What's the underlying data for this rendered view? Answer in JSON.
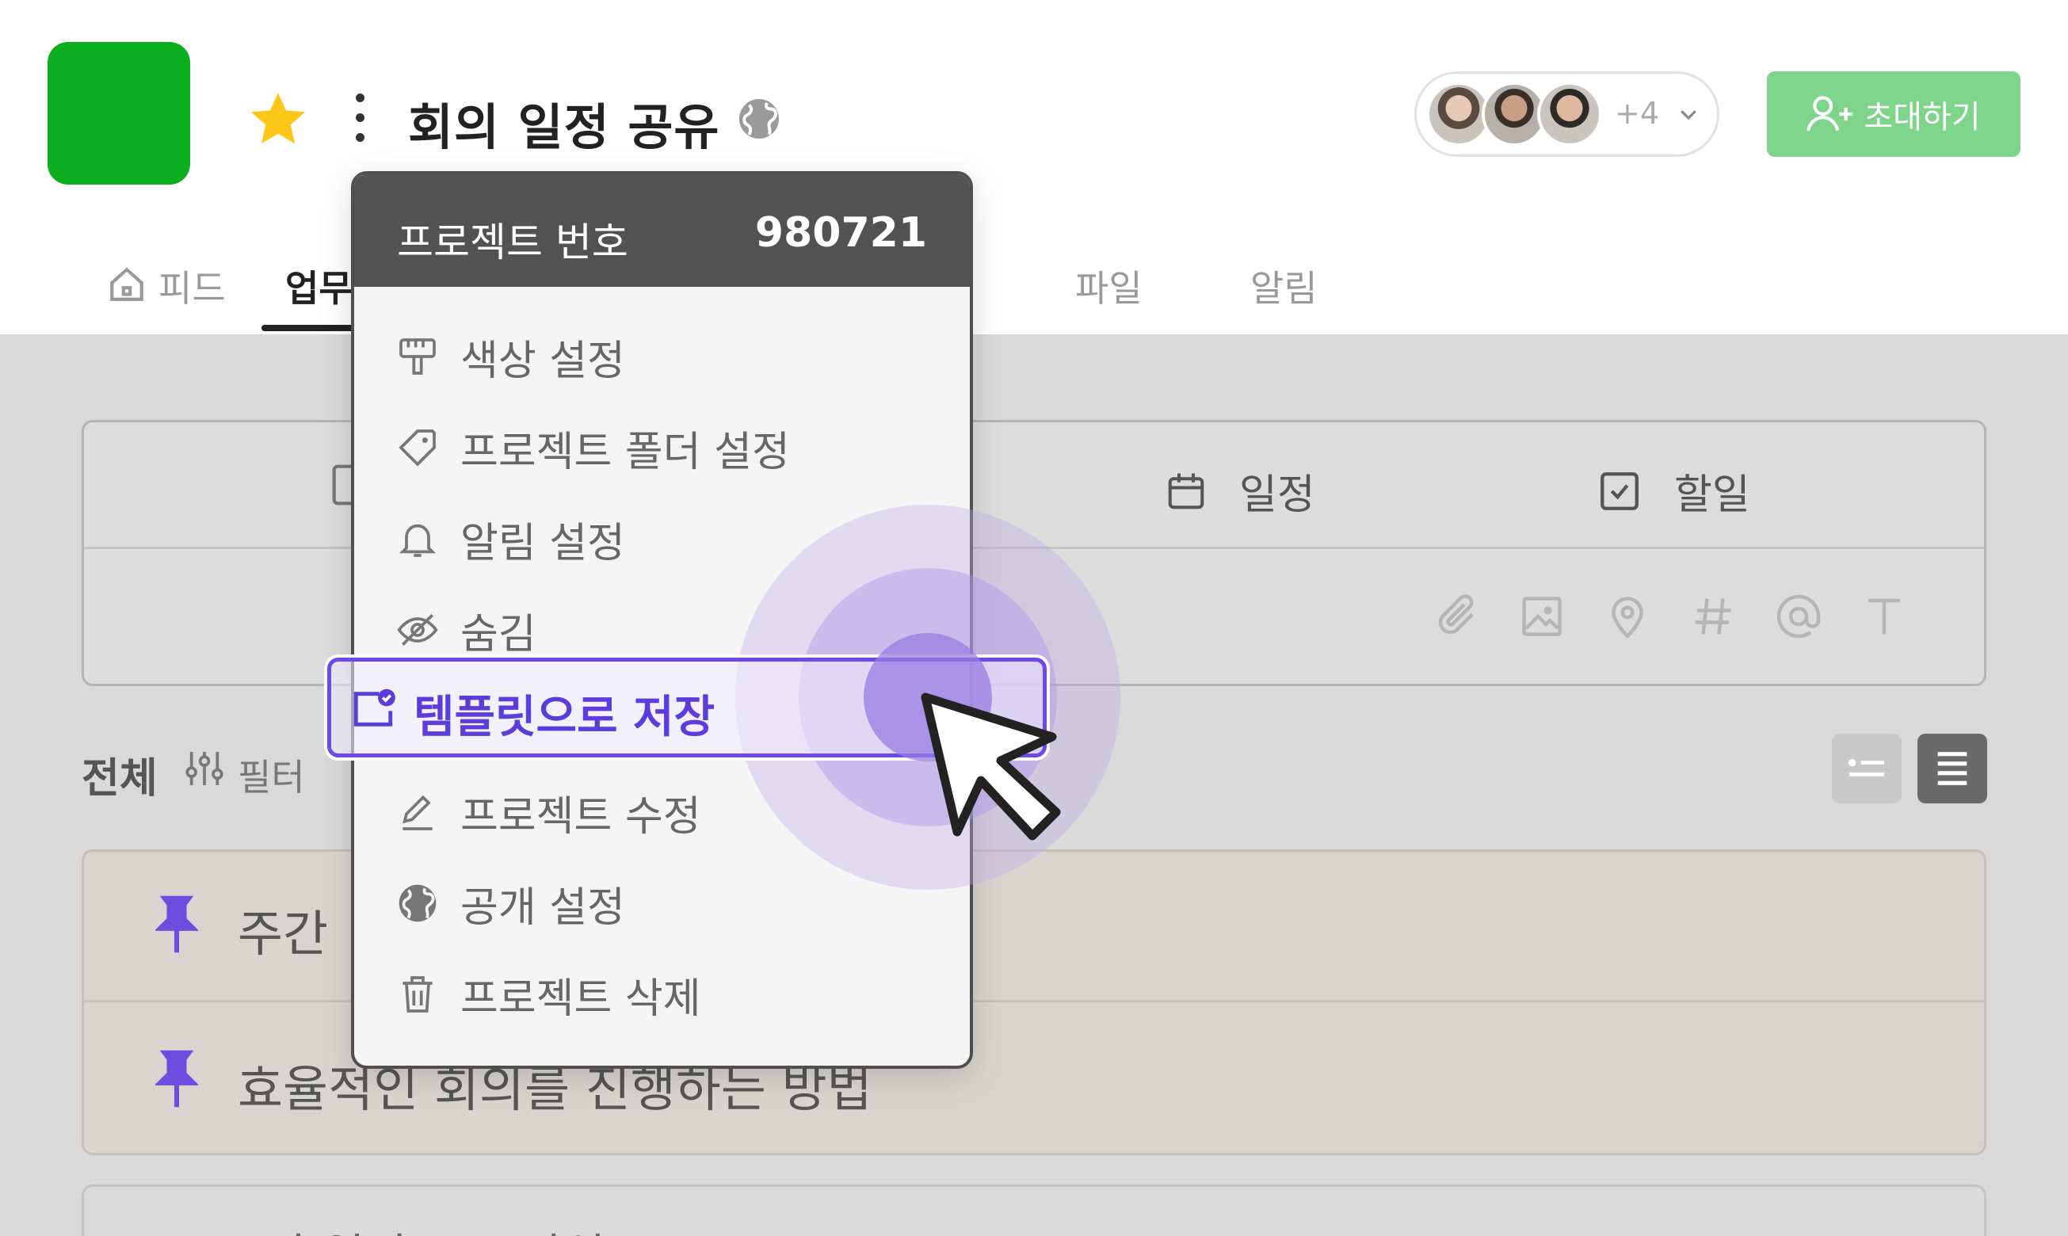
{
  "header": {
    "title": "회의 일정 공유",
    "member_more": "+4",
    "invite_label": "초대하기",
    "accent_color": "#0aae1f"
  },
  "tabs": [
    {
      "label": "피드"
    },
    {
      "label": "업무"
    },
    {
      "label": "파일"
    },
    {
      "label": "알림"
    }
  ],
  "composer": {
    "tabs": [
      {
        "label": "일정"
      },
      {
        "label": "할일"
      }
    ],
    "tools": [
      "paperclip-icon",
      "image-icon",
      "location-icon",
      "hashtag-icon",
      "mention-icon",
      "text-icon"
    ]
  },
  "filter_bar": {
    "all_label": "전체",
    "filter_label": "필터"
  },
  "pinned": [
    {
      "title": "주간 "
    },
    {
      "title": "효율적인 회의를 진행하는 방법"
    }
  ],
  "bottom_card_title": "주간 일정 보고 양식",
  "menu": {
    "header_label": "프로젝트 번호",
    "header_value": "980721",
    "items": [
      {
        "label": "색상 설정",
        "icon": "paint-brush-icon"
      },
      {
        "label": "프로젝트 폴더 설정",
        "icon": "tag-icon"
      },
      {
        "label": "알림 설정",
        "icon": "bell-icon"
      },
      {
        "label": "숨김",
        "icon": "eye-hidden-icon"
      },
      {
        "label": "템플릿으로 저장",
        "icon": "template-save-icon",
        "highlighted": true
      },
      {
        "label": "프로젝트 수정",
        "icon": "pencil-icon"
      },
      {
        "label": "공개 설정",
        "icon": "globe-icon"
      },
      {
        "label": "프로젝트 삭제",
        "icon": "trash-icon"
      }
    ],
    "highlight_color": "#6c49e8"
  }
}
